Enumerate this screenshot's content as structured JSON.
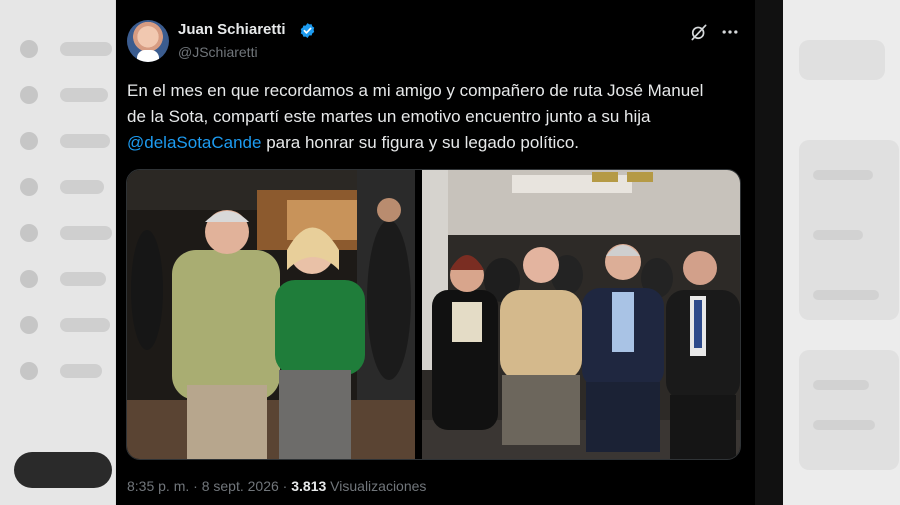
{
  "tweet": {
    "author_name": "Juan Schiaretti",
    "handle": "@JSchiaretti",
    "verified_icon": "verified-badge-icon",
    "text_before": "En el mes en que recordamos a mi amigo y compañero de ruta José Manuel de la Sota, compartí este martes un emotivo encuentro junto a su hija ",
    "mention": "@delaSotaCande",
    "text_after": " para honrar su figura y su legado político.",
    "time": "8:35 p. m.",
    "separator": "·",
    "date": "8 sept. 2026",
    "separator2": "·",
    "views_count": "3.813",
    "views_label": "Visualizaciones",
    "accent_color": "#1d9bf0"
  }
}
